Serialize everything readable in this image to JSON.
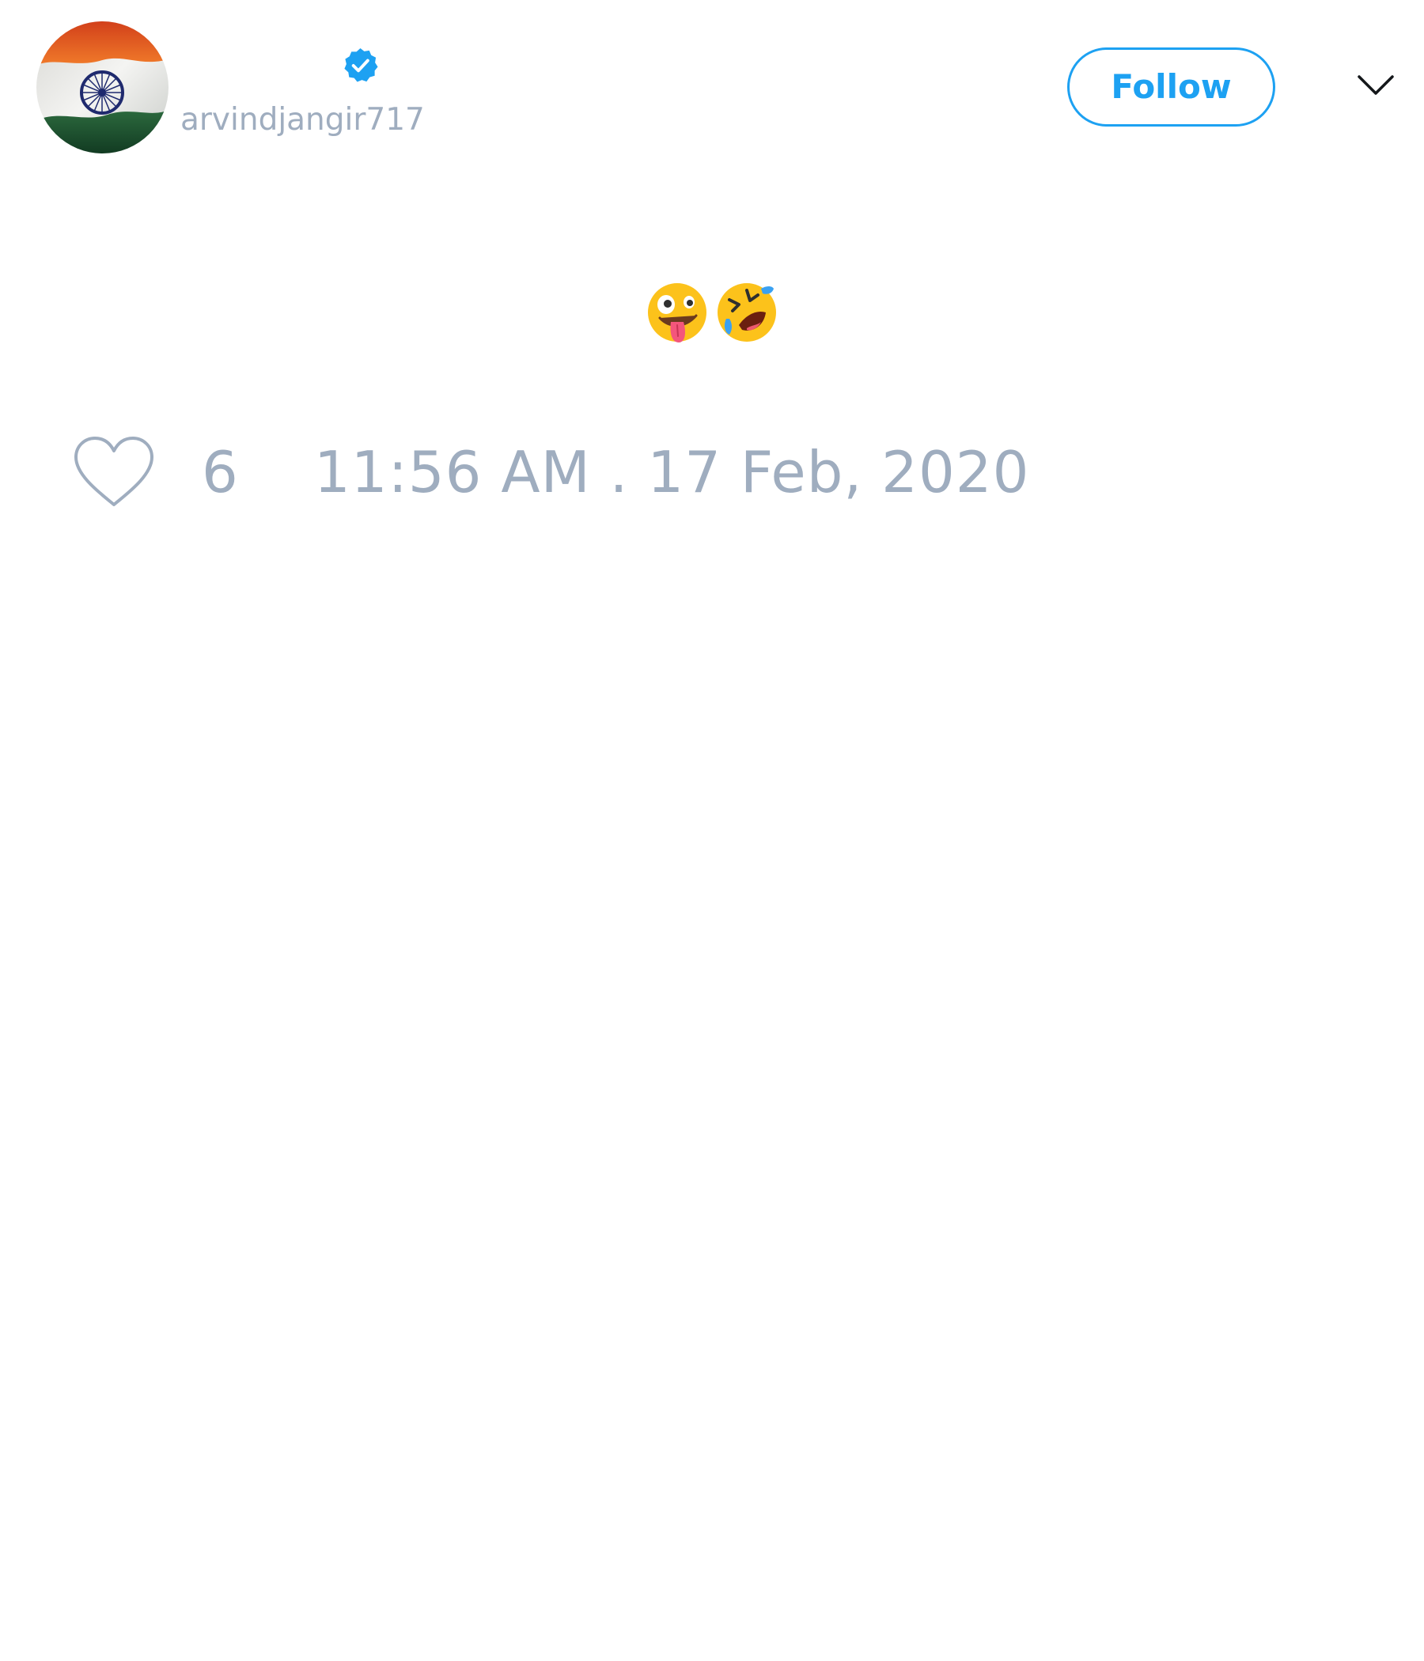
{
  "header": {
    "handle": "arvindjangir717",
    "follow_label": "Follow",
    "verified": true
  },
  "tweet": {
    "emojis": [
      "zany-face-emoji",
      "rolling-on-floor-laughing-emoji"
    ]
  },
  "footer": {
    "like_count": "6",
    "timestamp": "11:56 AM . 17 Feb, 2020"
  },
  "colors": {
    "accent": "#1da1f2",
    "muted_text": "#9fadbf",
    "background": "#ffffff"
  },
  "icons": {
    "avatar": "india-flag-avatar",
    "verified": "verified-badge-icon",
    "menu": "chevron-down-icon",
    "like": "heart-icon"
  }
}
